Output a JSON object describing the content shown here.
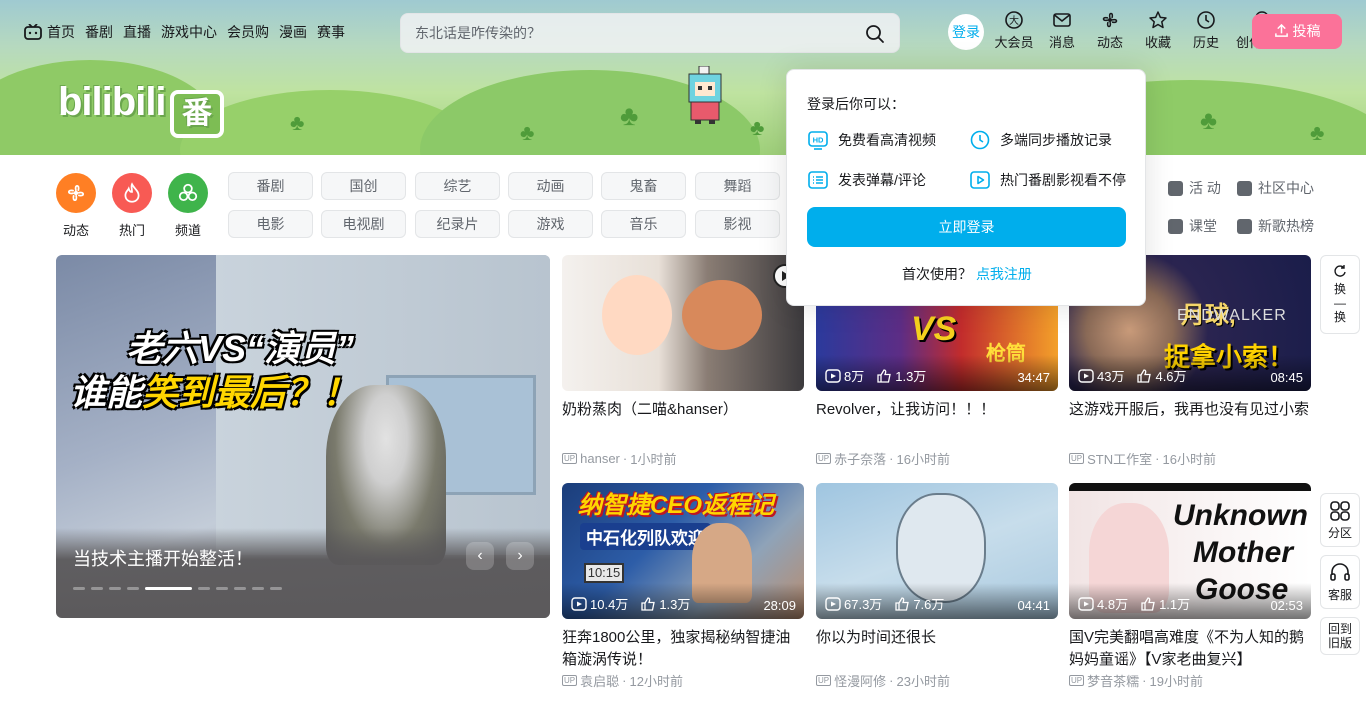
{
  "nav": {
    "left": [
      "首页",
      "番剧",
      "直播",
      "游戏中心",
      "会员购",
      "漫画",
      "赛事"
    ],
    "search_placeholder": "东北话是咋传染的？",
    "login": "登录",
    "right": [
      "大会员",
      "消息",
      "动态",
      "收藏",
      "历史",
      "创作中心"
    ],
    "upload": "投稿"
  },
  "banner": {
    "logo_text": "bilibili",
    "logo_badge": "番"
  },
  "channels": {
    "big": [
      "动态",
      "热门",
      "频道"
    ],
    "tags_row1": [
      "番剧",
      "国创",
      "综艺",
      "动画",
      "鬼畜",
      "舞蹈"
    ],
    "tags_row2": [
      "电影",
      "电视剧",
      "纪录片",
      "游戏",
      "音乐",
      "影视"
    ],
    "extras": [
      "活 动",
      "社区中心",
      "课堂",
      "新歌热榜"
    ]
  },
  "carousel": {
    "headline_line1_a": "老六VS“",
    "headline_line1_b": "演员",
    "headline_line1_c": "”",
    "headline_line2_a": "谁能",
    "headline_line2_b": "笑到最后？！",
    "title": "当技术主播开始整活！",
    "prev": "‹",
    "next": "›",
    "active_dot": 4,
    "dot_count": 10
  },
  "videos": [
    {
      "title": "奶粉蒸肉（二喵&hanser）",
      "author": "hanser",
      "time": "1小时前",
      "views": "",
      "likes": "",
      "duration": ""
    },
    {
      "title": "Revolver，让我访问！！！",
      "author": "赤子奈落",
      "time": "16小时前",
      "views": "8万",
      "likes": "1.3万",
      "duration": "34:47"
    },
    {
      "title": "这游戏开服后，我再也没有见过小索",
      "author": "STN工作室",
      "time": "16小时前",
      "views": "43万",
      "likes": "4.6万",
      "duration": "08:45"
    },
    {
      "title": "狂奔1800公里，独家揭秘纳智捷油箱漩涡传说！",
      "author": "袁启聪",
      "time": "12小时前",
      "views": "10.4万",
      "likes": "1.3万",
      "duration": "28:09"
    },
    {
      "title": "你以为时间还很长",
      "author": "怪漫阿修",
      "time": "23小时前",
      "views": "67.3万",
      "likes": "7.6万",
      "duration": "04:41"
    },
    {
      "title": "国V完美翻唱高难度《不为人知的鹅妈妈童谣》【V家老曲复兴】",
      "author": "梦音茶糯",
      "time": "19小时前",
      "views": "4.8万",
      "likes": "1.1万",
      "duration": "02:53"
    }
  ],
  "thumb_text": {
    "t2_right": "VS",
    "t2_bottom": "枪筒",
    "t3_top": "月球,",
    "t3_mid": "ENDWALKER",
    "t3_bottom": "捉拿小索！",
    "t4_top": "纳智捷CEO返程记",
    "t4_sub": "中石化列队欢迎",
    "t4_pump": "10:15",
    "t6_line1": "Unknown",
    "t6_line2": "Mother",
    "t6_line3": "Goose"
  },
  "side": {
    "refresh": "换一换",
    "refresh_chars": [
      "换",
      "—",
      "换"
    ],
    "zone": "分区",
    "service": "客服",
    "old_1": "回到",
    "old_2": "旧版"
  },
  "popup": {
    "title": "登录后你可以：",
    "perks": [
      "免费看高清视频",
      "多端同步播放记录",
      "发表弹幕/评论",
      "热门番剧影视看不停"
    ],
    "button": "立即登录",
    "first": "首次使用？",
    "register": "点我注册"
  },
  "colors": {
    "accent": "#00aeec",
    "pink": "#fb7299",
    "orange": "#ff7f24",
    "red": "#f85a54",
    "green": "#3fb44b"
  }
}
